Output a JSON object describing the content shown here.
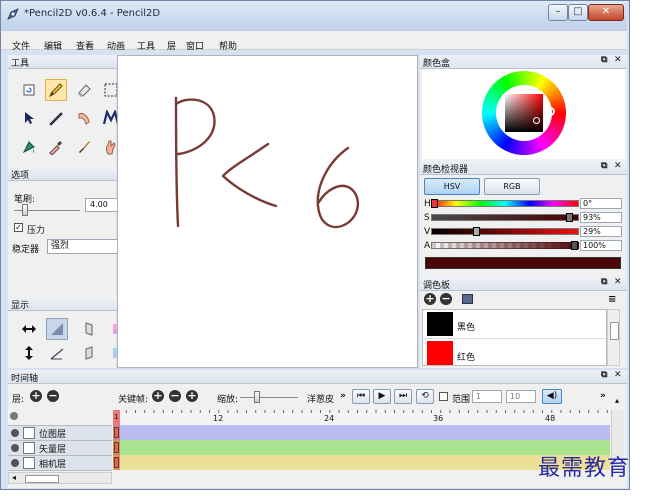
{
  "window": {
    "title": "*Pencil2D v0.6.4 - Pencil2D"
  },
  "menu": [
    "文件",
    "编辑",
    "查看",
    "动画",
    "工具",
    "层",
    "窗口",
    "帮助"
  ],
  "tools_panel": {
    "title": "工具"
  },
  "options_panel": {
    "title": "选项",
    "brush_label": "笔刷:",
    "brush_value": "4.00",
    "pressure_label": "压力",
    "stabilizer_label": "稳定器",
    "stabilizer_value": "强烈"
  },
  "display_panel": {
    "title": "显示"
  },
  "color_box": {
    "title": "颜色盒"
  },
  "color_inspector": {
    "title": "颜色检视器",
    "hsv_label": "HSV",
    "rgb_label": "RGB",
    "channels": [
      {
        "label": "H",
        "value": "0°"
      },
      {
        "label": "S",
        "value": "93%"
      },
      {
        "label": "V",
        "value": "29%"
      },
      {
        "label": "A",
        "value": "100%"
      }
    ],
    "current_color": "#4a0606"
  },
  "palette": {
    "title": "调色板",
    "swatches": [
      {
        "name": "黑色",
        "color": "#000000"
      },
      {
        "name": "红色",
        "color": "#ff0000"
      }
    ]
  },
  "timeline": {
    "title": "时间轴",
    "layers_label": "层:",
    "keyframe_label": "关键帧:",
    "zoom_label": "缩放:",
    "onion_label": "洋葱皮",
    "range_label": "范围",
    "range_start": "1",
    "range_end": "10",
    "ruler_labels": [
      "1",
      "12",
      "24",
      "36",
      "48"
    ],
    "layers": [
      {
        "name": "位图层",
        "color": "#b9bdf0"
      },
      {
        "name": "矢量层",
        "color": "#a9e38f"
      },
      {
        "name": "相机层",
        "color": "#ecdf96"
      }
    ]
  },
  "watermark": "最需教育"
}
